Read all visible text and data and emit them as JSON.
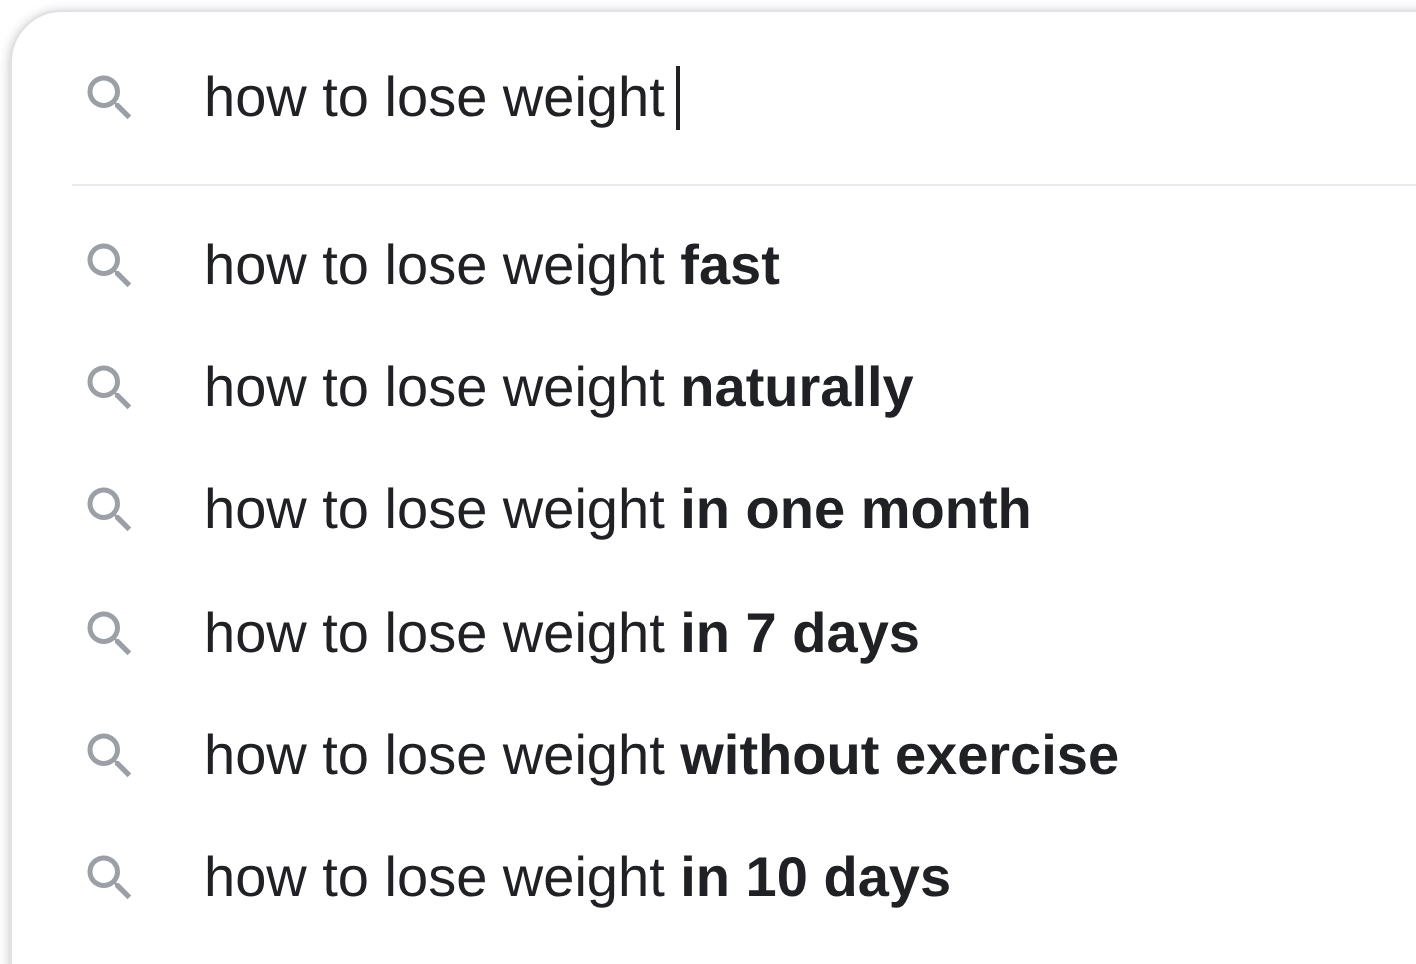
{
  "search": {
    "value": "how to lose weight"
  },
  "suggestions": [
    {
      "text": "how to lose weight **fast**"
    },
    {
      "text": "how to lose weight **naturally**"
    },
    {
      "text": "how to lose weight **in one month**"
    },
    {
      "text": "how to lose weight **in 7 days**"
    },
    {
      "text": "how to lose weight **without exercise**"
    },
    {
      "text": "how to lose weight **in 10 days**"
    }
  ]
}
